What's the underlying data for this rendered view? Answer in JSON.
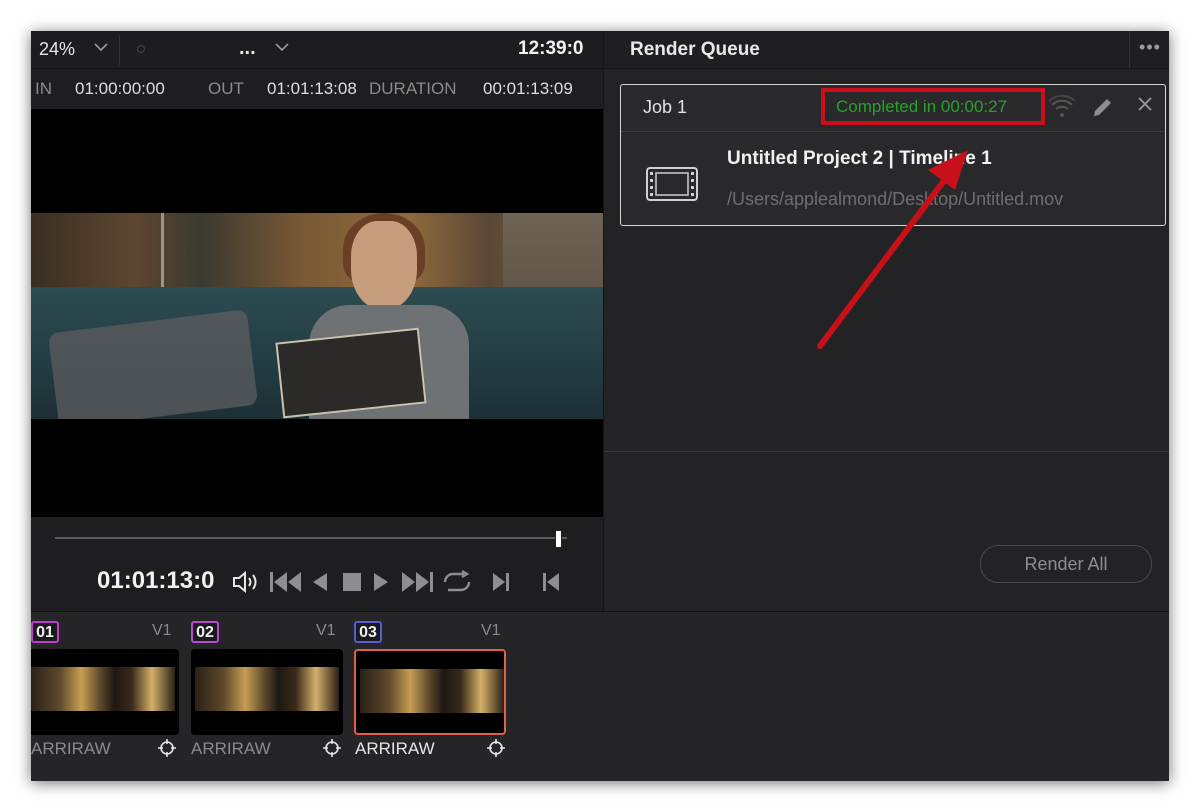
{
  "viewer": {
    "zoom": "24%",
    "clip_name": "...",
    "timecode_top": "12:39:0",
    "in_label": "IN",
    "in_value": "01:00:00:00",
    "out_label": "OUT",
    "out_value": "01:01:13:08",
    "duration_label": "DURATION",
    "duration_value": "00:01:13:09",
    "timecode": "01:01:13:0",
    "playhead_progress": 0.98
  },
  "render_queue": {
    "title": "Render Queue",
    "more": "•••",
    "jobs": [
      {
        "name": "Job 1",
        "status": "Completed in 00:00:27",
        "status_color": "#28a12d",
        "title": "Untitled Project 2 | Timeline 1",
        "path": "/Users/applealmond/Desktop/Untitled.mov"
      }
    ],
    "render_all_label": "Render All"
  },
  "clips": [
    {
      "number": "01",
      "track": "V1",
      "codec": "ARRIRAW",
      "selected": false
    },
    {
      "number": "02",
      "track": "V1",
      "codec": "ARRIRAW",
      "selected": false
    },
    {
      "number": "03",
      "track": "V1",
      "codec": "ARRIRAW",
      "selected": true
    }
  ],
  "colors": {
    "highlight": "#c8101a",
    "selected_clip": "#e35f4d",
    "status_green": "#28a12d"
  }
}
